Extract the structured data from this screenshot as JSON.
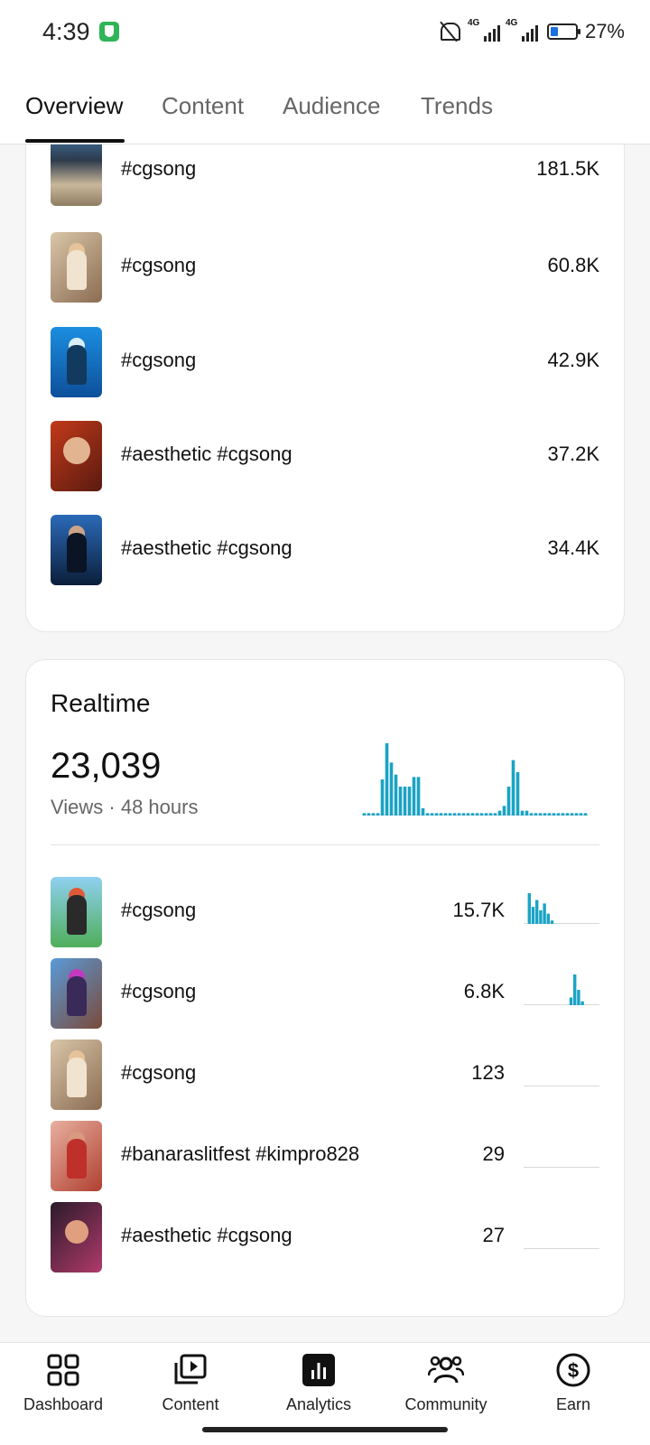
{
  "status": {
    "time": "4:39",
    "signal1": "4G",
    "signal2": "4G",
    "battery": "27%"
  },
  "tabs": [
    {
      "label": "Overview",
      "active": true
    },
    {
      "label": "Content",
      "active": false
    },
    {
      "label": "Audience",
      "active": false
    },
    {
      "label": "Trends",
      "active": false
    }
  ],
  "top_content": [
    {
      "title": "#cgsong",
      "views": "181.5K"
    },
    {
      "title": "#cgsong",
      "views": "60.8K"
    },
    {
      "title": "#cgsong",
      "views": "42.9K"
    },
    {
      "title": "#aesthetic #cgsong",
      "views": "37.2K"
    },
    {
      "title": "#aesthetic #cgsong",
      "views": "34.4K"
    }
  ],
  "realtime": {
    "title": "Realtime",
    "value": "23,039",
    "subtitle": "Views · 48 hours",
    "chart_color": "#1aa3c4",
    "bars": [
      1,
      1,
      1,
      1,
      15,
      30,
      22,
      17,
      12,
      12,
      12,
      16,
      16,
      3,
      1,
      1,
      1,
      1,
      1,
      1,
      1,
      1,
      1,
      1,
      1,
      1,
      1,
      1,
      1,
      1,
      2,
      4,
      12,
      23,
      18,
      2,
      2,
      1,
      1,
      1,
      1,
      1,
      1,
      1,
      1,
      1,
      1,
      1,
      1,
      1
    ],
    "items": [
      {
        "title": "#cgsong",
        "views": "15.7K",
        "spark": [
          0,
          9,
          5,
          7,
          4,
          6,
          3,
          1,
          0,
          0,
          0,
          0,
          0,
          0,
          0,
          0,
          0,
          0,
          0,
          0
        ]
      },
      {
        "title": "#cgsong",
        "views": "6.8K",
        "spark": [
          0,
          0,
          0,
          0,
          0,
          0,
          0,
          0,
          0,
          0,
          0,
          0,
          2,
          8,
          4,
          1,
          0,
          0,
          0,
          0
        ]
      },
      {
        "title": "#cgsong",
        "views": "123",
        "spark": [
          0,
          0,
          0,
          0,
          0,
          0,
          0,
          0,
          0,
          0,
          0,
          0,
          0,
          0,
          0,
          0,
          0,
          0,
          0,
          0
        ]
      },
      {
        "title": "#banaraslitfest #kimpro828",
        "views": "29",
        "spark": [
          0,
          0,
          0,
          0,
          0,
          0,
          0,
          0,
          0,
          0,
          0,
          0,
          0,
          0,
          0,
          0,
          0,
          0,
          0,
          0
        ]
      },
      {
        "title": "#aesthetic #cgsong",
        "views": "27",
        "spark": [
          0,
          0,
          0,
          0,
          0,
          0,
          0,
          0,
          0,
          0,
          0,
          0,
          0,
          0,
          0,
          0,
          0,
          0,
          0,
          0
        ]
      }
    ]
  },
  "nav": [
    {
      "label": "Dashboard",
      "icon": "dashboard-icon"
    },
    {
      "label": "Content",
      "icon": "content-icon"
    },
    {
      "label": "Analytics",
      "icon": "analytics-icon"
    },
    {
      "label": "Community",
      "icon": "community-icon"
    },
    {
      "label": "Earn",
      "icon": "earn-icon"
    }
  ]
}
